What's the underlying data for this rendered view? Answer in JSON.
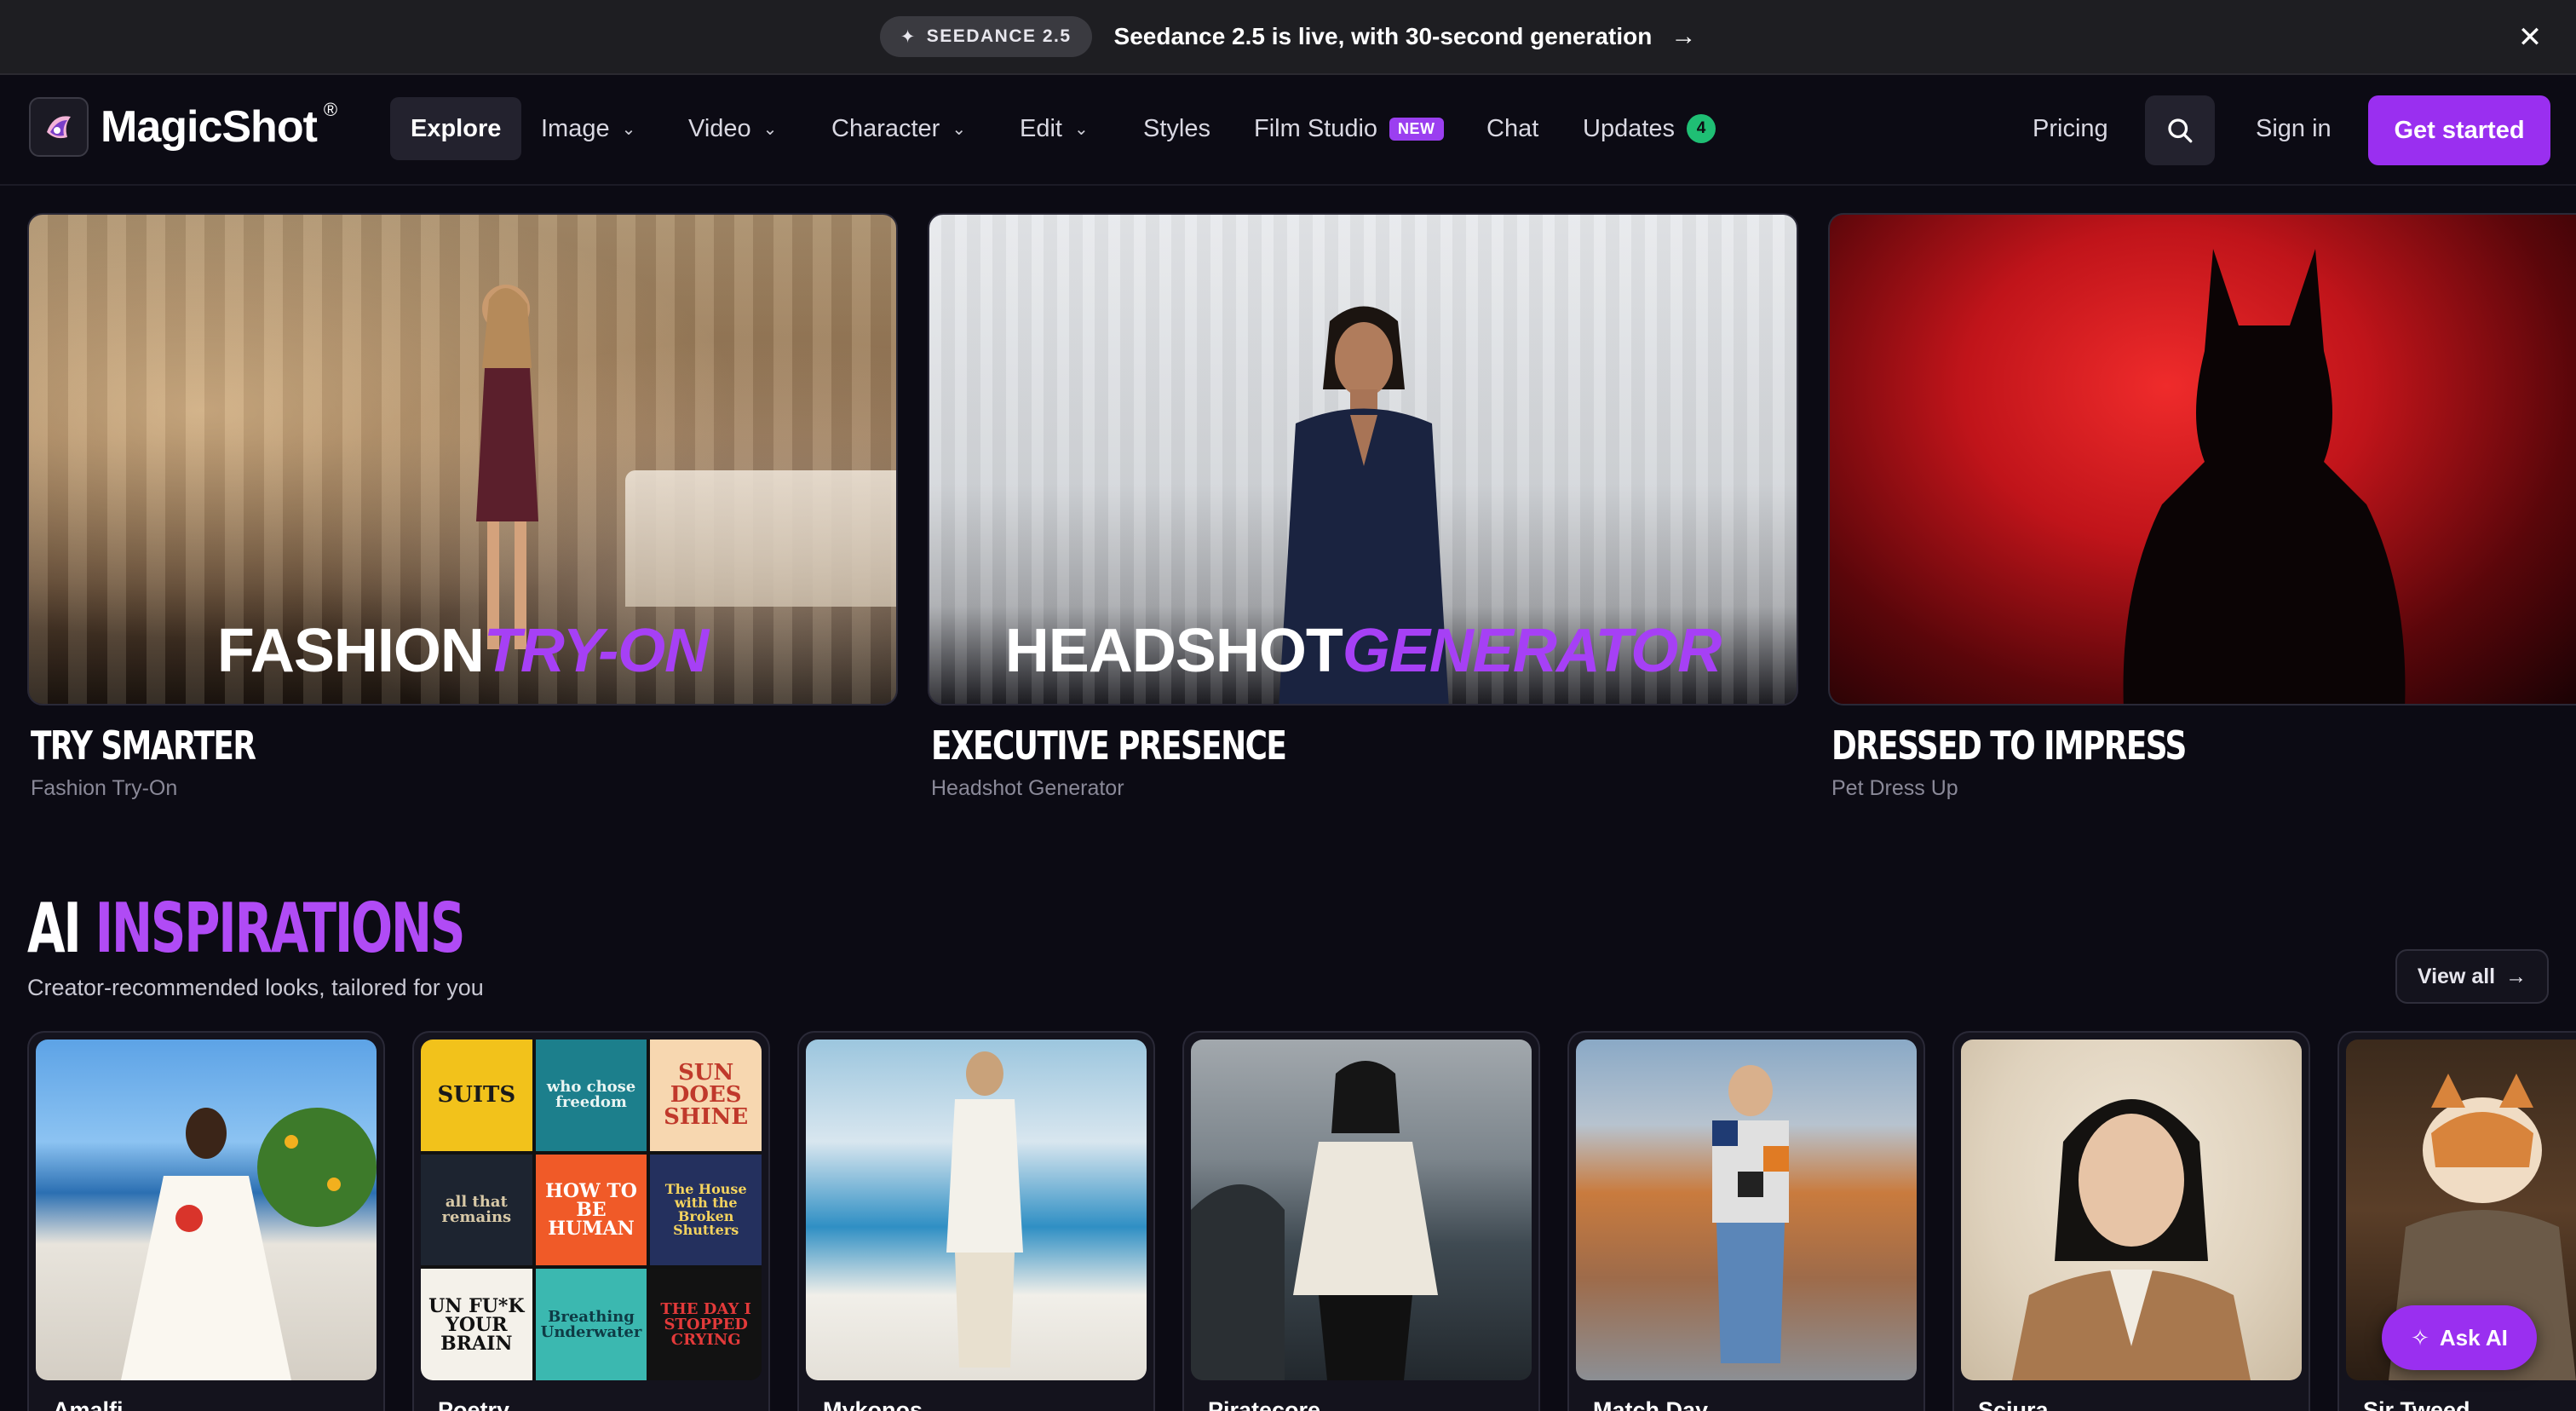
{
  "announcement": {
    "badge": "SEEDANCE 2.5",
    "text": "Seedance 2.5 is live, with 30-second generation"
  },
  "nav": {
    "logo": "MagicShot",
    "items": [
      {
        "label": "Explore",
        "dropdown": false
      },
      {
        "label": "Image",
        "dropdown": true
      },
      {
        "label": "Video",
        "dropdown": true
      },
      {
        "label": "Character",
        "dropdown": true
      },
      {
        "label": "Edit",
        "dropdown": true
      },
      {
        "label": "Styles",
        "dropdown": false
      },
      {
        "label": "Film Studio",
        "badge": "NEW"
      },
      {
        "label": "Chat",
        "dropdown": false
      },
      {
        "label": "Updates",
        "count": "4"
      }
    ],
    "pricing": "Pricing",
    "sign_in": "Sign in",
    "cta": "Get started"
  },
  "features": [
    {
      "overlay_white": "FASHION",
      "overlay_purple": "TRY-ON",
      "title": "TRY SMARTER",
      "subtitle": "Fashion Try-On"
    },
    {
      "overlay_white": "HEADSHOT",
      "overlay_purple": "GENERATOR",
      "title": "EXECUTIVE PRESENCE",
      "subtitle": "Headshot Generator"
    },
    {
      "title": "DRESSED TO IMPRESS",
      "subtitle": "Pet Dress Up"
    }
  ],
  "inspirations": {
    "title_white": "AI",
    "title_purple": "INSPIRATIONS",
    "subtitle": "Creator-recommended looks, tailored for you",
    "view_all": "View all",
    "tiles": [
      {
        "label": "Amalfi"
      },
      {
        "label": "Poetry"
      },
      {
        "label": "Mykonos"
      },
      {
        "label": "Piratecore"
      },
      {
        "label": "Match Day"
      },
      {
        "label": "Sciura"
      },
      {
        "label": "Sir Tweed"
      }
    ],
    "poetry_books": [
      {
        "text": "SUITS",
        "bg": "#f2c21b",
        "fg": "#1a1a1a"
      },
      {
        "text": "who chose freedom",
        "bg": "#1c7f8c",
        "fg": "#e8f4f2"
      },
      {
        "text": "SUN DOES SHINE",
        "bg": "#f7d7b0",
        "fg": "#c0392b"
      },
      {
        "text": "all that remains",
        "bg": "#1d2430",
        "fg": "#d8c9a7"
      },
      {
        "text": "HOW TO BE HUMAN",
        "bg": "#f05a28",
        "fg": "#ffffff"
      },
      {
        "text": "The House with the Broken Shutters",
        "bg": "#24305e",
        "fg": "#f4d35e"
      },
      {
        "text": "UN FU*K YOUR BRAIN",
        "bg": "#f4f1ea",
        "fg": "#111111"
      },
      {
        "text": "Breathing Underwater",
        "bg": "#3bb8b0",
        "fg": "#0e3b45"
      },
      {
        "text": "THE DAY I STOPPED CRYING",
        "bg": "#121212",
        "fg": "#e33a3a"
      }
    ]
  },
  "ask_ai": "Ask AI",
  "colors": {
    "accent": "#9a2ff0",
    "background": "#0c0b14",
    "updates_badge": "#1fbf74"
  }
}
